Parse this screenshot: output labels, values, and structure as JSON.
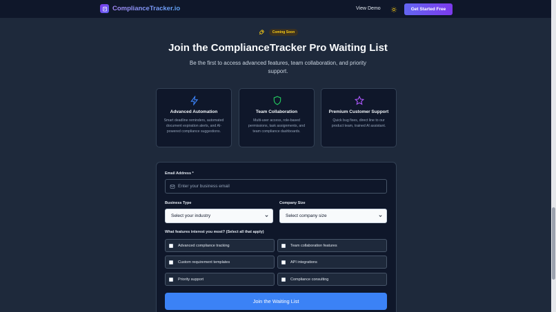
{
  "header": {
    "brand": "ComplianceTracker.io",
    "view_demo": "View Demo",
    "get_started": "Get Started Free"
  },
  "hero": {
    "badge": "Coming Soon",
    "title": "Join the ComplianceTracker Pro Waiting List",
    "subtitle": "Be the first to access advanced features, team collaboration, and priority support."
  },
  "features": [
    {
      "icon": "lightning-icon",
      "title": "Advanced Automation",
      "desc": "Smart deadline reminders, automated document expiration alerts, and AI-powered compliance suggestions."
    },
    {
      "icon": "shield-icon",
      "title": "Team Collaboration",
      "desc": "Multi-user access, role-based permissions, task assignments, and team compliance dashboards."
    },
    {
      "icon": "star-icon",
      "title": "Premium Customer Support",
      "desc": "Quick bug fixes, direct line to our product team, trained AI assistant."
    }
  ],
  "form": {
    "email_label": "Email Address *",
    "email_placeholder": "Enter your business email",
    "business_type_label": "Business Type",
    "business_type_value": "Select your industry",
    "company_size_label": "Company Size",
    "company_size_value": "Select company size",
    "features_label": "What features interest you most? (Select all that apply)",
    "options": [
      "Advanced compliance tracking",
      "Team collaboration features",
      "Custom requirement templates",
      "API integrations",
      "Priority support",
      "Compliance consulting"
    ],
    "submit": "Join the Waiting List"
  },
  "colors": {
    "background": "#1e293b",
    "panel": "#0f172a",
    "accent": "#3b82f6",
    "brand_gradient_start": "#6366f1",
    "brand_gradient_end": "#7c3aed",
    "badge_text": "#facc15"
  }
}
